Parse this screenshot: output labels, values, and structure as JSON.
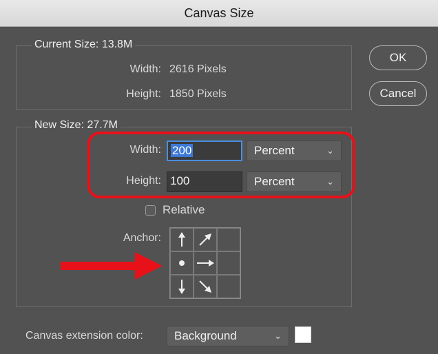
{
  "window": {
    "title": "Canvas Size"
  },
  "buttons": {
    "ok": "OK",
    "cancel": "Cancel"
  },
  "current_size": {
    "legend": "Current Size: 13.8M",
    "width_label": "Width:",
    "width_value": "2616 Pixels",
    "height_label": "Height:",
    "height_value": "1850 Pixels"
  },
  "new_size": {
    "legend": "New Size: 27.7M",
    "width_label": "Width:",
    "width_value": "200",
    "width_unit": "Percent",
    "height_label": "Height:",
    "height_value": "100",
    "height_unit": "Percent",
    "relative_label": "Relative",
    "relative_checked": false,
    "anchor_label": "Anchor:"
  },
  "extension": {
    "label": "Canvas extension color:",
    "value": "Background",
    "swatch_color": "#ffffff"
  },
  "annotation_color": "#e8111a"
}
